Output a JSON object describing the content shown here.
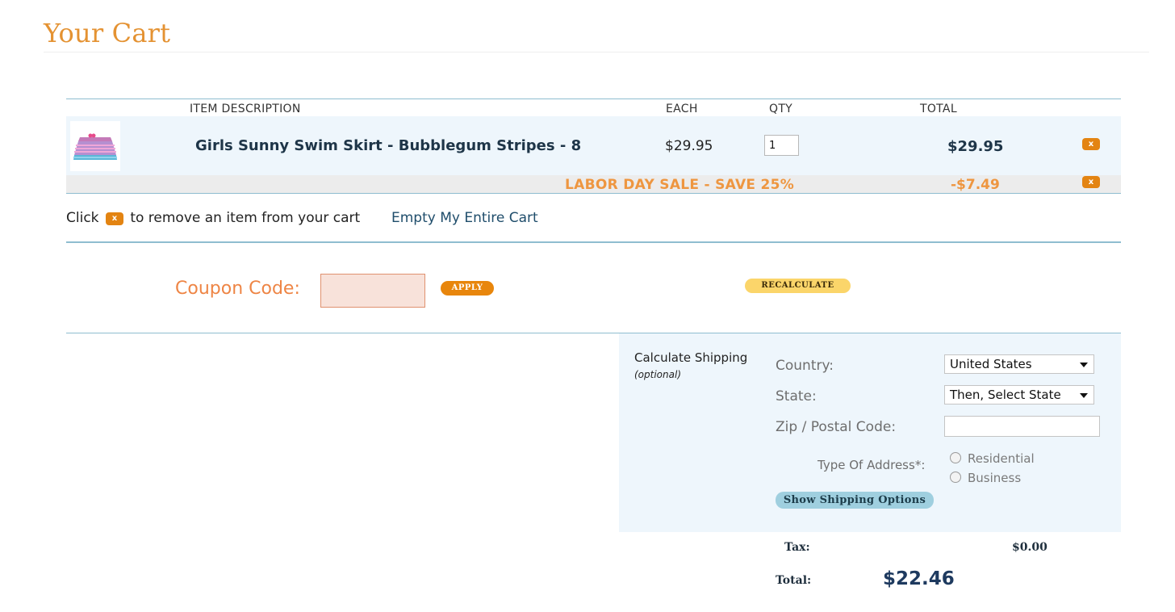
{
  "page": {
    "title": "Your Cart"
  },
  "cart": {
    "headers": {
      "item": "ITEM  DESCRIPTION",
      "each": "EACH",
      "qty": "QTY",
      "total": "TOTAL"
    },
    "items": [
      {
        "name": "Girls Sunny Swim Skirt - Bubblegum Stripes - 8",
        "each": "$29.95",
        "qty": "1",
        "total": "$29.95",
        "thumbnail_icon": "swim-skirt-thumbnail",
        "remove_label": "x"
      }
    ],
    "discount": {
      "label": "LABOR DAY SALE - SAVE 25%",
      "amount": "-$7.49",
      "remove_label": "x"
    }
  },
  "remove_hint": {
    "prefix": "Click",
    "icon_label": "x",
    "suffix": "to remove an item from your cart"
  },
  "empty_cart_label": "Empty My Entire Cart",
  "coupon": {
    "label": "Coupon Code:",
    "value": "",
    "apply_label": "APPLY"
  },
  "recalculate_label": "RECALCULATE",
  "shipping": {
    "title": "Calculate Shipping",
    "optional": "(optional)",
    "country_label": "Country:",
    "country_value": "United States",
    "state_label": "State:",
    "state_value": "Then, Select State",
    "zip_label": "Zip / Postal Code:",
    "zip_value": "",
    "address_type_label": "Type Of Address*:",
    "address_types": [
      "Residential",
      "Business"
    ],
    "show_options_label": "Show Shipping Options"
  },
  "summary": {
    "tax_label": "Tax:",
    "tax_value": "$0.00",
    "total_label": "Total:",
    "total_value": "$22.46"
  },
  "colors": {
    "accent_orange": "#e49232",
    "button_orange": "#e38412",
    "rule_blue": "#8fbdd0",
    "panel_blue": "#eef6fc"
  }
}
